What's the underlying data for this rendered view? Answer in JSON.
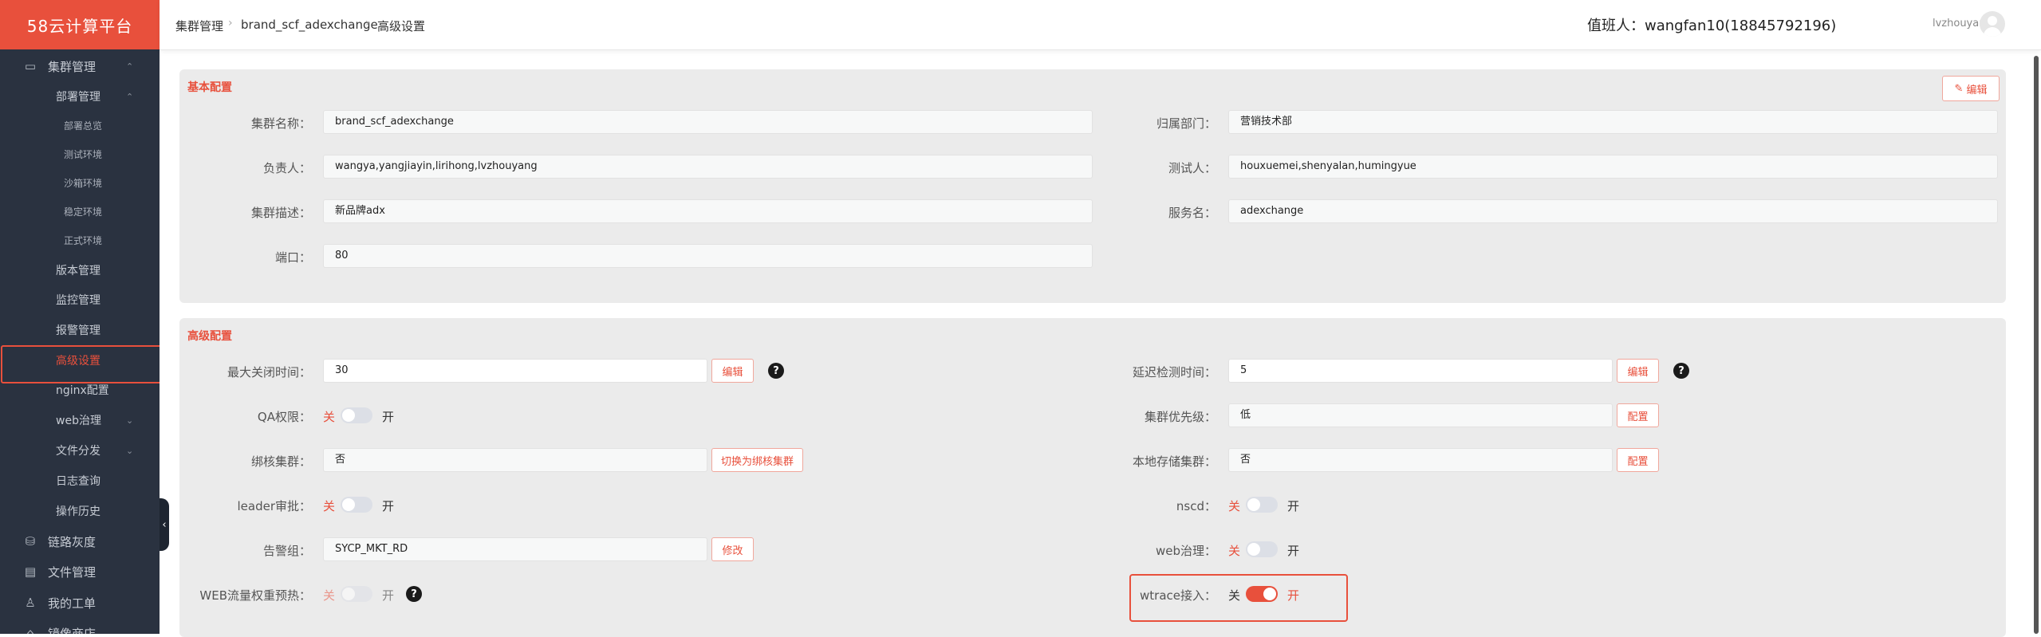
{
  "brand": "58云计算平台",
  "sidebar": {
    "items": [
      {
        "label": "集群管理",
        "chevron": "up"
      },
      {
        "label": "部署管理",
        "chevron": "up"
      },
      {
        "label": "部署总览"
      },
      {
        "label": "测试环境"
      },
      {
        "label": "沙箱环境"
      },
      {
        "label": "稳定环境"
      },
      {
        "label": "正式环境"
      },
      {
        "label": "版本管理"
      },
      {
        "label": "监控管理"
      },
      {
        "label": "报警管理"
      },
      {
        "label": "高级设置",
        "active": true
      },
      {
        "label": "nginx配置"
      },
      {
        "label": "web治理",
        "chevron": "down"
      },
      {
        "label": "文件分发",
        "chevron": "down"
      },
      {
        "label": "日志查询"
      },
      {
        "label": "操作历史"
      },
      {
        "label": "链路灰度"
      },
      {
        "label": "文件管理"
      },
      {
        "label": "我的工单"
      },
      {
        "label": "镜像商店"
      }
    ]
  },
  "breadcrumb": [
    "集群管理",
    "brand_scf_adexchange",
    "高级设置"
  ],
  "duty": "值班人：wangfan10(18845792196)",
  "username": "lvzhouyang",
  "basic": {
    "title": "基本配置",
    "edit": "编辑",
    "cluster_name_label": "集群名称：",
    "cluster_name": "brand_scf_adexchange",
    "dept_label": "归属部门：",
    "dept": "营销技术部",
    "owner_label": "负责人：",
    "owner": "wangya,yangjiayin,lirihong,lvzhouyang",
    "tester_label": "测试人：",
    "tester": "houxuemei,shenyalan,humingyue",
    "desc_label": "集群描述：",
    "desc": "新品牌adx",
    "service_label": "服务名：",
    "service": "adexchange",
    "port_label": "端口：",
    "port": "80"
  },
  "advanced": {
    "title": "高级配置",
    "max_close_label": "最大关闭时间：",
    "max_close": "30",
    "delay_label": "延迟检测时间：",
    "delay": "5",
    "edit": "编辑",
    "qa_label": "QA权限：",
    "priority_label": "集群优先级：",
    "priority": "低",
    "config": "配置",
    "bind_label": "绑核集群：",
    "bind": "否",
    "switch_bind": "切换为绑核集群",
    "local_label": "本地存储集群：",
    "local": "否",
    "leader_label": "leader审批：",
    "nscd_label": "nscd：",
    "alarm_label": "告警组：",
    "alarm": "SYCP_MKT_RD",
    "modify": "修改",
    "web_gov_label": "web治理：",
    "web_warm_label": "WEB流量权重预热：",
    "wtrace_label": "wtrace接入：",
    "off": "关",
    "on": "开",
    "help": "?"
  }
}
